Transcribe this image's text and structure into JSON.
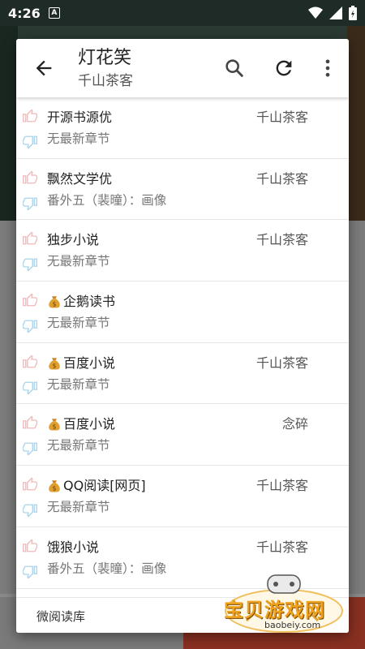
{
  "status_bar": {
    "time": "4:26",
    "notification_glyph": "A"
  },
  "header": {
    "title": "灯花笑",
    "subtitle": "千山茶客",
    "icons": [
      "back-arrow-icon",
      "search-icon",
      "refresh-icon",
      "more-vert-icon"
    ]
  },
  "sources": [
    {
      "name": "开源书源优",
      "paid": false,
      "author": "千山茶客",
      "chapter": "无最新章节"
    },
    {
      "name": "飘然文学优",
      "paid": false,
      "author": "千山茶客",
      "chapter": "番外五（裴曈）：画像"
    },
    {
      "name": "独步小说",
      "paid": false,
      "author": "千山茶客",
      "chapter": "无最新章节"
    },
    {
      "name": "企鹅读书",
      "paid": true,
      "author": "",
      "chapter": "无最新章节"
    },
    {
      "name": "百度小说",
      "paid": true,
      "author": "千山茶客",
      "chapter": "无最新章节"
    },
    {
      "name": "百度小说",
      "paid": true,
      "author": "念碎",
      "chapter": "无最新章节"
    },
    {
      "name": "QQ阅读[网页]",
      "paid": true,
      "author": "千山茶客",
      "chapter": "无最新章节"
    },
    {
      "name": "饿狼小说",
      "paid": false,
      "author": "千山茶客",
      "chapter": "番外五（裴曈）：画像"
    }
  ],
  "footer": {
    "text": "微阅读库"
  },
  "watermark": {
    "title": "宝贝游戏网",
    "url": "baobeiy.com"
  },
  "colors": {
    "thumb_up": "#f2b8b8",
    "thumb_down": "#a9d3ea",
    "money_bag": "#e0a030"
  }
}
